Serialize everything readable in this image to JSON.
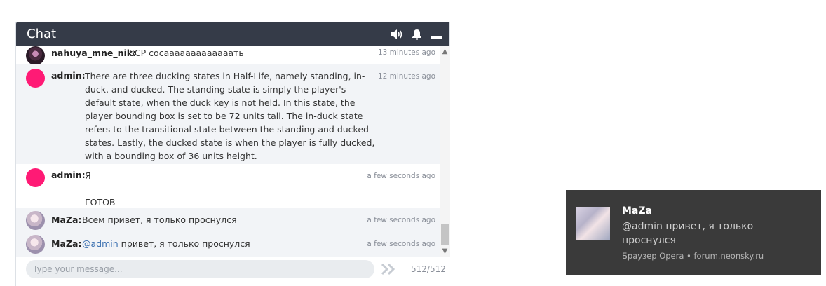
{
  "chat": {
    "title": "Chat",
    "icons": [
      "speaker-icon",
      "bell-icon",
      "minimize-icon"
    ],
    "messages": [
      {
        "author": "nahuya_mne_nik:",
        "text": "SCP сосааааааааааааать",
        "time": "13 minutes ago",
        "avatar": "dark"
      },
      {
        "author": "admin:",
        "text": "There are three ducking states in Half-Life, namely standing, in-\nduck, and ducked. The standing state is simply the player's\ndefault state, when the duck key is not held. In this state, the\nplayer bounding box is set to be 72 units tall. The in-duck state\nrefers to the transitional state between the standing and ducked\nstates. Lastly, the ducked state is when the player is fully ducked,\nwith a bounding box of 36 units height.",
        "time": "12 minutes ago",
        "avatar": "pink"
      },
      {
        "author": "admin:",
        "text": "Я\n\nГОТОВ",
        "time": "a few seconds ago",
        "avatar": "pink"
      },
      {
        "author": "MaZa:",
        "text": "Всем привет, я только проснулся",
        "time": "a few seconds ago",
        "avatar": "anime"
      },
      {
        "author": "MaZa:",
        "mention": "@admin",
        "text": " привет, я только проснулся",
        "time": "a few seconds ago",
        "avatar": "anime"
      }
    ],
    "input": {
      "placeholder": "Type your message...",
      "value": ""
    },
    "counter": "512/512",
    "colors": {
      "header": "#353b48",
      "admin_avatar": "#ff1a75",
      "mention": "#3a6fb0"
    }
  },
  "notification": {
    "title": "MaZa",
    "body": "@admin привет, я только проснулся",
    "source": "Браузер Opera • forum.neonsky.ru",
    "background": "#3a3a3a"
  }
}
